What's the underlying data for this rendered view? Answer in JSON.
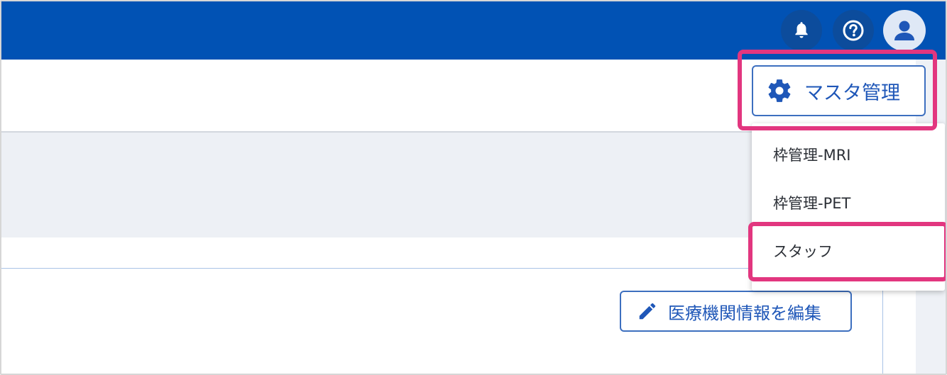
{
  "header": {
    "notifications_icon": "bell-icon",
    "help_icon": "help-circle-icon",
    "account_icon": "user-icon"
  },
  "menu": {
    "master_label": "マスタ管理",
    "master_icon": "gear-icon",
    "items": [
      {
        "label": "枠管理-MRI"
      },
      {
        "label": "枠管理-PET"
      },
      {
        "label": "スタッフ"
      }
    ]
  },
  "main": {
    "edit_button_label": "医療機関情報を編集",
    "edit_icon": "pencil-icon"
  },
  "colors": {
    "header_bg": "#0152b4",
    "accent": "#1f57b8",
    "highlight": "#e2367f",
    "panel_bg": "#edf0f5"
  }
}
